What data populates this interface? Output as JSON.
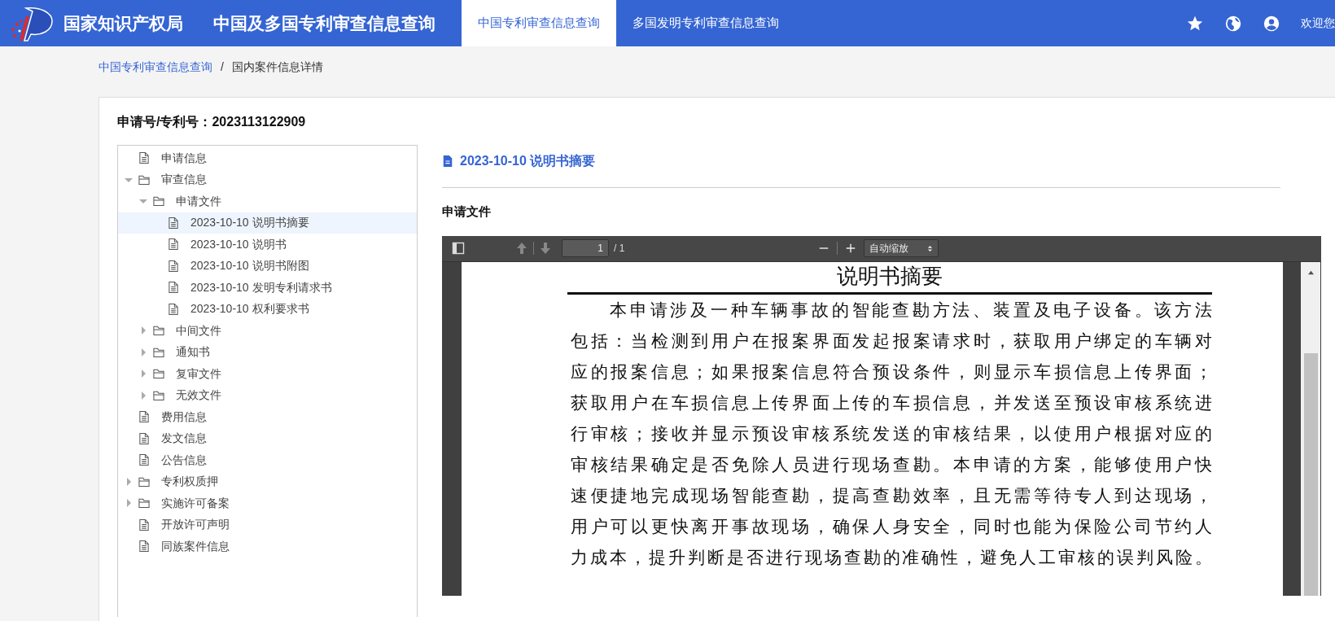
{
  "header": {
    "site_title": "国家知识产权局",
    "app_title": "中国及多国专利审查信息查询",
    "welcome": "欢迎您",
    "tabs": [
      {
        "label": "中国专利审查信息查询",
        "selected": true
      },
      {
        "label": "多国发明专利审查信息查询",
        "selected": false
      }
    ]
  },
  "breadcrumb": {
    "separator": "/",
    "items": [
      {
        "label": "中国专利审查信息查询",
        "kind": "link"
      },
      {
        "label": "国内案件信息详情",
        "kind": "current"
      }
    ]
  },
  "case": {
    "label": "申请号/专利号：",
    "number": "2023113122909"
  },
  "tree": [
    {
      "label": "申请信息",
      "kind": "file",
      "selected": false
    },
    {
      "label": "审查信息",
      "kind": "folder",
      "expanded": true,
      "selected": false,
      "children": [
        {
          "label": "申请文件",
          "kind": "folder",
          "expanded": true,
          "selected": false,
          "children": [
            {
              "label": "2023-10-10 说明书摘要",
              "kind": "file",
              "selected": true
            },
            {
              "label": "2023-10-10 说明书",
              "kind": "file",
              "selected": false
            },
            {
              "label": "2023-10-10 说明书附图",
              "kind": "file",
              "selected": false
            },
            {
              "label": "2023-10-10 发明专利请求书",
              "kind": "file",
              "selected": false
            },
            {
              "label": "2023-10-10 权利要求书",
              "kind": "file",
              "selected": false
            }
          ]
        },
        {
          "label": "中间文件",
          "kind": "folder",
          "expanded": false,
          "selected": false
        },
        {
          "label": "通知书",
          "kind": "folder",
          "expanded": false,
          "selected": false
        },
        {
          "label": "复审文件",
          "kind": "folder",
          "expanded": false,
          "selected": false
        },
        {
          "label": "无效文件",
          "kind": "folder",
          "expanded": false,
          "selected": false
        }
      ]
    },
    {
      "label": "费用信息",
      "kind": "file",
      "selected": false
    },
    {
      "label": "发文信息",
      "kind": "file",
      "selected": false
    },
    {
      "label": "公告信息",
      "kind": "file",
      "selected": false
    },
    {
      "label": "专利权质押",
      "kind": "folder",
      "expanded": false,
      "selected": false
    },
    {
      "label": "实施许可备案",
      "kind": "folder",
      "expanded": false,
      "selected": false
    },
    {
      "label": "开放许可声明",
      "kind": "file",
      "selected": false
    },
    {
      "label": "同族案件信息",
      "kind": "file",
      "selected": false
    }
  ],
  "document": {
    "title": "2023-10-10 说明书摘要",
    "section": "申请文件"
  },
  "viewer": {
    "page": "1",
    "page_count": "/ 1",
    "zoom": "自动缩放",
    "page_title": "说明书摘要",
    "lines": [
      "本申请涉及一种车辆事故的智能查勘方法、装置及电子设备。该方法",
      "包括：当检测到用户在报案界面发起报案请求时，获取用户绑定的车辆对",
      "应的报案信息；如果报案信息符合预设条件，则显示车损信息上传界面；",
      "获取用户在车损信息上传界面上传的车损信息，并发送至预设审核系统进",
      "行审核；接收并显示预设审核系统发送的审核结果，以使用户根据对应的",
      "审核结果确定是否免除人员进行现场查勘。本申请的方案，能够使用户快",
      "速便捷地完成现场智能查勘，提高查勘效率，且无需等待专人到达现场，",
      "用户可以更快离开事故现场，确保人身安全，同时也能为保险公司节约人",
      "力成本，提升判断是否进行现场查勘的准确性，避免人工审核的误判风险。"
    ]
  }
}
